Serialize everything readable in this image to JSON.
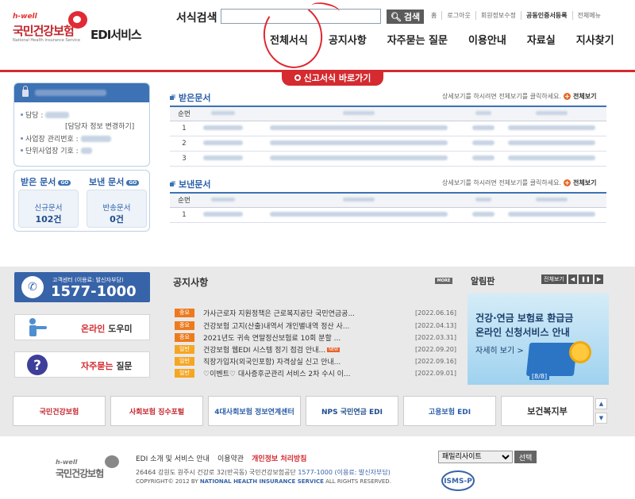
{
  "header": {
    "logo_hwell": "h-well",
    "logo_name": "국민건강보험",
    "logo_en": "National Health Insurance Service",
    "logo_service": "EDI서비스",
    "search_label": "서식검색",
    "search_value": "",
    "search_button": "검색",
    "top_links": [
      "홈",
      "로그아웃",
      "회원정보수정",
      "공동인증서등록",
      "전체메뉴"
    ],
    "nav": [
      "전체서식",
      "공지사항",
      "자주묻는 질문",
      "이용안내",
      "자료실",
      "지사찾기"
    ],
    "quick_button": "신고서식 바로가기"
  },
  "user_panel": {
    "manager_label": "담당 :",
    "change_link": "[담당자 정보 변경하기]",
    "biz_no_label": "사업장 관리번호 :",
    "unit_label": "단위사업장 기호 :"
  },
  "doc_counts": {
    "received": {
      "title": "받은 문서",
      "badge": "GO",
      "label": "신규문서",
      "count": "102건"
    },
    "sent": {
      "title": "보낸 문서",
      "badge": "GO",
      "label": "반송문서",
      "count": "0건"
    }
  },
  "received_section": {
    "title": "받은문서",
    "hint": "상세보기를 하시려면 전체보기를 클릭하세요.",
    "view_all": "전체보기",
    "column_no": "순번",
    "rows": [
      "1",
      "2",
      "3"
    ]
  },
  "sent_section": {
    "title": "보낸문서",
    "hint": "상세보기를 하시려면 전체보기를 클릭하세요.",
    "view_all": "전체보기",
    "column_no": "순번",
    "rows": [
      "1"
    ]
  },
  "callcenter": {
    "sub": "고객센터 (이용료: 발신자부담)",
    "number": "1577-1000"
  },
  "side_buttons": {
    "help_prefix": "온라인",
    "help_suffix": " 도우미",
    "faq_prefix": "자주묻는",
    "faq_suffix": " 질문"
  },
  "notices": {
    "title": "공지사항",
    "more": "MORE",
    "items": [
      {
        "badge": "중요",
        "type": "important",
        "title": "가사근로자 지원정책은 근로복지공단 국민연금공...",
        "date": "[2022.06.16]",
        "new": false
      },
      {
        "badge": "중요",
        "type": "important",
        "title": "건강보험 고지(산출)내역서 개인별내역 정산 사...",
        "date": "[2022.04.13]",
        "new": false
      },
      {
        "badge": "중요",
        "type": "important",
        "title": "2021년도 귀속 연말정산보험료 10회 분할 ...",
        "date": "[2022.03.31]",
        "new": false
      },
      {
        "badge": "일반",
        "type": "general",
        "title": "건강보험 웹EDI 시스템 정기 점검 안내...",
        "date": "[2022.09.20]",
        "new": true
      },
      {
        "badge": "일반",
        "type": "general",
        "title": "직장가입자(외국인포함) 자격상실 신고 안내...",
        "date": "[2022.09.16]",
        "new": false
      },
      {
        "badge": "일반",
        "type": "general",
        "title": "♡이벤트♡ 대사증후군관리 서비스 2차 수시 이...",
        "date": "[2022.09.01]",
        "new": false
      }
    ],
    "new_label": "NEW"
  },
  "alimpan": {
    "title": "알림판",
    "view_all": "전체보기",
    "line1": "건강·연금 보험료 환급금",
    "line2": "온라인 신청서비스 안내",
    "more": "자세히 보기 >",
    "page": "[8/8]"
  },
  "banners": [
    "국민건강보험",
    "사회보험 징수포털",
    "4대사회보험 정보연계센터",
    "NPS 국민연금 EDI",
    "고용보험 EDI",
    "보건복지부"
  ],
  "footer": {
    "links": [
      "EDI 소개 및 서비스 안내",
      "이용약관",
      "개인정보 처리방침"
    ],
    "address": "26464 강원도 원주시 건강로 32(반곡동) 국민건강보험공단",
    "hotline": "1577-1000 (이용료: 발신자부담)",
    "copyright_prefix": "COPYRIGHT© 2012 BY ",
    "copyright_org": "NATIONAL HEALTH INSURANCE SERVICE",
    "copyright_suffix": " ALL RIGHTS RESERVED.",
    "family_site": "패밀리사이트",
    "family_button": "선택",
    "isms": "ISMS-P"
  },
  "colors": {
    "brand_red": "#d42a30",
    "brand_blue": "#3d72b4"
  }
}
